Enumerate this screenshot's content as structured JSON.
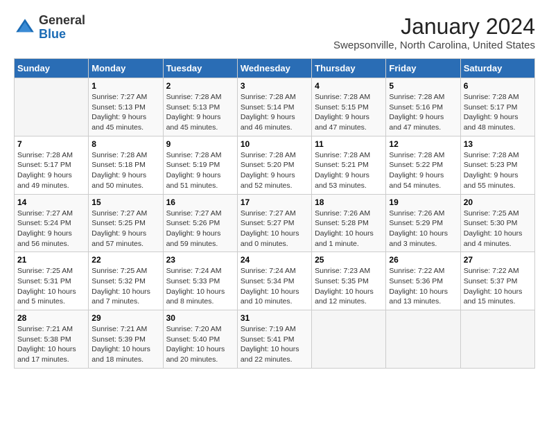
{
  "header": {
    "logo_general": "General",
    "logo_blue": "Blue",
    "month": "January 2024",
    "location": "Swepsonville, North Carolina, United States"
  },
  "days_of_week": [
    "Sunday",
    "Monday",
    "Tuesday",
    "Wednesday",
    "Thursday",
    "Friday",
    "Saturday"
  ],
  "weeks": [
    [
      {
        "day": "",
        "info": ""
      },
      {
        "day": "1",
        "info": "Sunrise: 7:27 AM\nSunset: 5:13 PM\nDaylight: 9 hours\nand 45 minutes."
      },
      {
        "day": "2",
        "info": "Sunrise: 7:28 AM\nSunset: 5:13 PM\nDaylight: 9 hours\nand 45 minutes."
      },
      {
        "day": "3",
        "info": "Sunrise: 7:28 AM\nSunset: 5:14 PM\nDaylight: 9 hours\nand 46 minutes."
      },
      {
        "day": "4",
        "info": "Sunrise: 7:28 AM\nSunset: 5:15 PM\nDaylight: 9 hours\nand 47 minutes."
      },
      {
        "day": "5",
        "info": "Sunrise: 7:28 AM\nSunset: 5:16 PM\nDaylight: 9 hours\nand 47 minutes."
      },
      {
        "day": "6",
        "info": "Sunrise: 7:28 AM\nSunset: 5:17 PM\nDaylight: 9 hours\nand 48 minutes."
      }
    ],
    [
      {
        "day": "7",
        "info": "Sunrise: 7:28 AM\nSunset: 5:17 PM\nDaylight: 9 hours\nand 49 minutes."
      },
      {
        "day": "8",
        "info": "Sunrise: 7:28 AM\nSunset: 5:18 PM\nDaylight: 9 hours\nand 50 minutes."
      },
      {
        "day": "9",
        "info": "Sunrise: 7:28 AM\nSunset: 5:19 PM\nDaylight: 9 hours\nand 51 minutes."
      },
      {
        "day": "10",
        "info": "Sunrise: 7:28 AM\nSunset: 5:20 PM\nDaylight: 9 hours\nand 52 minutes."
      },
      {
        "day": "11",
        "info": "Sunrise: 7:28 AM\nSunset: 5:21 PM\nDaylight: 9 hours\nand 53 minutes."
      },
      {
        "day": "12",
        "info": "Sunrise: 7:28 AM\nSunset: 5:22 PM\nDaylight: 9 hours\nand 54 minutes."
      },
      {
        "day": "13",
        "info": "Sunrise: 7:28 AM\nSunset: 5:23 PM\nDaylight: 9 hours\nand 55 minutes."
      }
    ],
    [
      {
        "day": "14",
        "info": "Sunrise: 7:27 AM\nSunset: 5:24 PM\nDaylight: 9 hours\nand 56 minutes."
      },
      {
        "day": "15",
        "info": "Sunrise: 7:27 AM\nSunset: 5:25 PM\nDaylight: 9 hours\nand 57 minutes."
      },
      {
        "day": "16",
        "info": "Sunrise: 7:27 AM\nSunset: 5:26 PM\nDaylight: 9 hours\nand 59 minutes."
      },
      {
        "day": "17",
        "info": "Sunrise: 7:27 AM\nSunset: 5:27 PM\nDaylight: 10 hours\nand 0 minutes."
      },
      {
        "day": "18",
        "info": "Sunrise: 7:26 AM\nSunset: 5:28 PM\nDaylight: 10 hours\nand 1 minute."
      },
      {
        "day": "19",
        "info": "Sunrise: 7:26 AM\nSunset: 5:29 PM\nDaylight: 10 hours\nand 3 minutes."
      },
      {
        "day": "20",
        "info": "Sunrise: 7:25 AM\nSunset: 5:30 PM\nDaylight: 10 hours\nand 4 minutes."
      }
    ],
    [
      {
        "day": "21",
        "info": "Sunrise: 7:25 AM\nSunset: 5:31 PM\nDaylight: 10 hours\nand 5 minutes."
      },
      {
        "day": "22",
        "info": "Sunrise: 7:25 AM\nSunset: 5:32 PM\nDaylight: 10 hours\nand 7 minutes."
      },
      {
        "day": "23",
        "info": "Sunrise: 7:24 AM\nSunset: 5:33 PM\nDaylight: 10 hours\nand 8 minutes."
      },
      {
        "day": "24",
        "info": "Sunrise: 7:24 AM\nSunset: 5:34 PM\nDaylight: 10 hours\nand 10 minutes."
      },
      {
        "day": "25",
        "info": "Sunrise: 7:23 AM\nSunset: 5:35 PM\nDaylight: 10 hours\nand 12 minutes."
      },
      {
        "day": "26",
        "info": "Sunrise: 7:22 AM\nSunset: 5:36 PM\nDaylight: 10 hours\nand 13 minutes."
      },
      {
        "day": "27",
        "info": "Sunrise: 7:22 AM\nSunset: 5:37 PM\nDaylight: 10 hours\nand 15 minutes."
      }
    ],
    [
      {
        "day": "28",
        "info": "Sunrise: 7:21 AM\nSunset: 5:38 PM\nDaylight: 10 hours\nand 17 minutes."
      },
      {
        "day": "29",
        "info": "Sunrise: 7:21 AM\nSunset: 5:39 PM\nDaylight: 10 hours\nand 18 minutes."
      },
      {
        "day": "30",
        "info": "Sunrise: 7:20 AM\nSunset: 5:40 PM\nDaylight: 10 hours\nand 20 minutes."
      },
      {
        "day": "31",
        "info": "Sunrise: 7:19 AM\nSunset: 5:41 PM\nDaylight: 10 hours\nand 22 minutes."
      },
      {
        "day": "",
        "info": ""
      },
      {
        "day": "",
        "info": ""
      },
      {
        "day": "",
        "info": ""
      }
    ]
  ]
}
